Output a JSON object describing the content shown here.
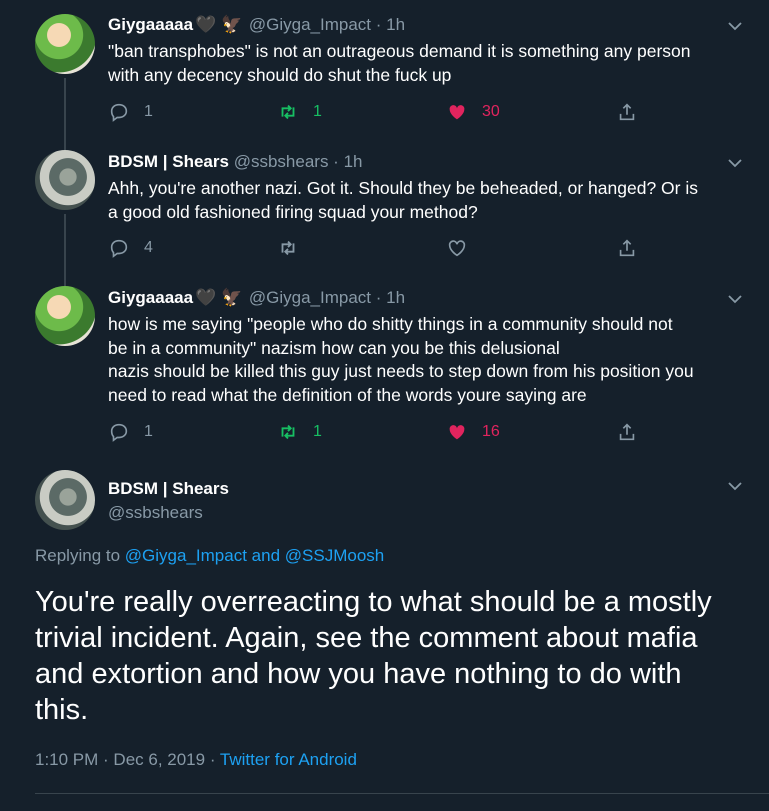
{
  "thread": [
    {
      "name": "Giygaaaaa",
      "emoji": "🖤 🦅",
      "handle": "@Giyga_Impact",
      "time": "1h",
      "lines": [
        "\"ban transphobes\" is not an outrageous demand it is something any person",
        "with any decency should do shut the fuck up"
      ],
      "replies": "1",
      "retweets": "1",
      "likes": "30",
      "liked": true,
      "retweeted": true
    },
    {
      "name": "BDSM | Shears",
      "emoji": "",
      "handle": "@ssbshears",
      "time": "1h",
      "lines": [
        "Ahh, you're another nazi. Got it. Should they be beheaded, or hanged? Or is",
        "a good old fashioned firing squad your method?"
      ],
      "replies": "4",
      "retweets": "",
      "likes": "",
      "liked": false,
      "retweeted": false
    },
    {
      "name": "Giygaaaaa",
      "emoji": "🖤 🦅",
      "handle": "@Giyga_Impact",
      "time": "1h",
      "lines": [
        "how is me saying \"people who do shitty things in a community should not",
        "be in a community\" nazism how can you be this delusional",
        "nazis should be killed this guy just needs to step down from his position you",
        "need to read what the definition of the words youre saying are"
      ],
      "replies": "1",
      "retweets": "1",
      "likes": "16",
      "liked": true,
      "retweeted": true
    }
  ],
  "main": {
    "name": "BDSM | Shears",
    "handle": "@ssbshears",
    "replying_prefix": "Replying to",
    "replying_user1": "@Giyga_Impact",
    "replying_and": "and",
    "replying_user2": "@SSJMoosh",
    "text_lines": [
      "You're really overreacting to what should be a mostly",
      "trivial incident. Again, see the comment about mafia",
      "and extortion and how you have nothing to do with",
      "this."
    ],
    "timestamp": "1:10 PM · Dec 6, 2019 ·",
    "client": "Twitter for Android"
  },
  "colors": {
    "background": "#15202b",
    "muted": "#8899a6",
    "link": "#1da1f2",
    "retweet_green": "#17bf63",
    "like_red": "#e0245e"
  },
  "icons": [
    "reply-icon",
    "retweet-icon",
    "like-icon",
    "share-icon",
    "chevron-down-icon"
  ]
}
